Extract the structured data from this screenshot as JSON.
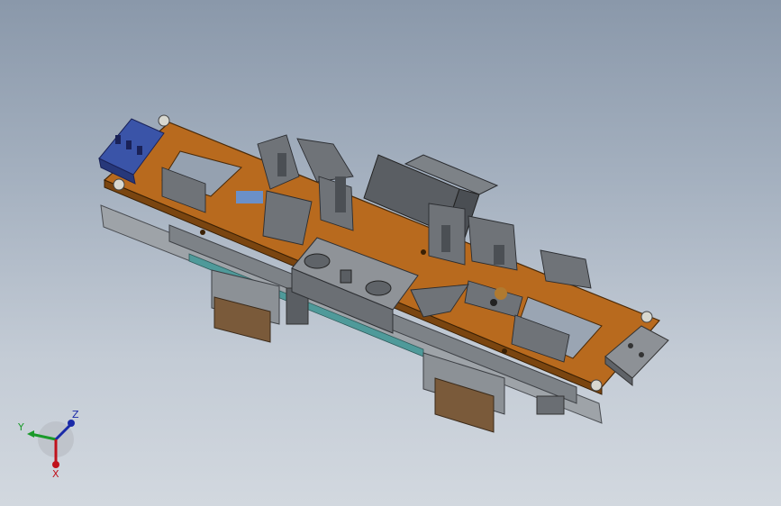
{
  "triad": {
    "x_label": "X",
    "y_label": "Y",
    "z_label": "Z",
    "colors": {
      "x": "#c0121c",
      "y": "#1a9a2a",
      "z": "#1a2aa8"
    }
  },
  "colors": {
    "background_top": "#8a98aa",
    "background_bottom": "#d2d8df",
    "base_plate": "#b86a1e",
    "metal": "#6f7378",
    "metal_dark": "#4b4f54",
    "blue_fixture": "#3a54a8",
    "bronze": "#7a5a3a"
  }
}
